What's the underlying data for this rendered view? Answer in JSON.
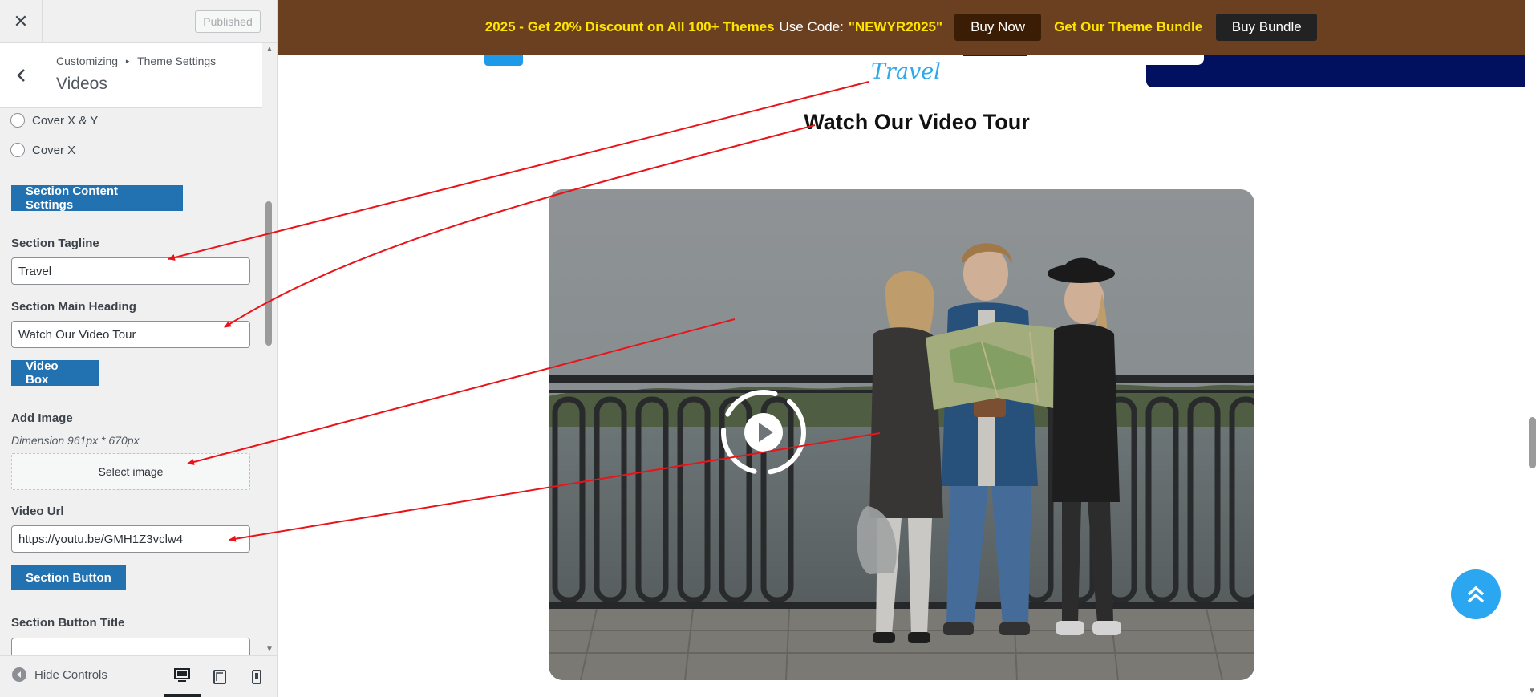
{
  "sidebar": {
    "published_label": "Published",
    "breadcrumb": {
      "root": "Customizing",
      "separator": "▸",
      "parent": "Theme Settings"
    },
    "panel_title": "Videos",
    "radio_options": [
      "Cover X & Y",
      "Cover X"
    ],
    "section_content_settings_label": "Section Content Settings",
    "tagline": {
      "label": "Section Tagline",
      "value": "Travel"
    },
    "main_heading": {
      "label": "Section Main Heading",
      "value": "Watch Our Video Tour"
    },
    "video_box_label": "Video Box",
    "add_image": {
      "label": "Add Image",
      "description": "Dimension 961px * 670px",
      "button": "Select image"
    },
    "video_url": {
      "label": "Video Url",
      "value": "https://youtu.be/GMH1Z3vclw4"
    },
    "section_button_label": "Section Button",
    "button_title": {
      "label": "Section Button Title",
      "value": ""
    },
    "footer": {
      "hide_controls": "Hide Controls",
      "devices": [
        "desktop-icon",
        "tablet-icon",
        "mobile-icon"
      ],
      "active_device": "desktop"
    }
  },
  "promo": {
    "headline": "2025 - Get 20% Discount on All 100+ Themes",
    "use_code_label": "Use Code:",
    "code": "\"NEWYR2025\"",
    "buy_now": "Buy Now",
    "bundle_text": "Get Our Theme Bundle",
    "buy_bundle": "Buy Bundle",
    "background_color": "#6b4020",
    "highlight_color": "#ffe400"
  },
  "section": {
    "tagline": "Travel",
    "heading": "Watch Our Video Tour",
    "accent_color": "#2ba9ec"
  },
  "colors": {
    "annotation_arrow": "#e8141a",
    "wp_blue": "#2271b1"
  }
}
